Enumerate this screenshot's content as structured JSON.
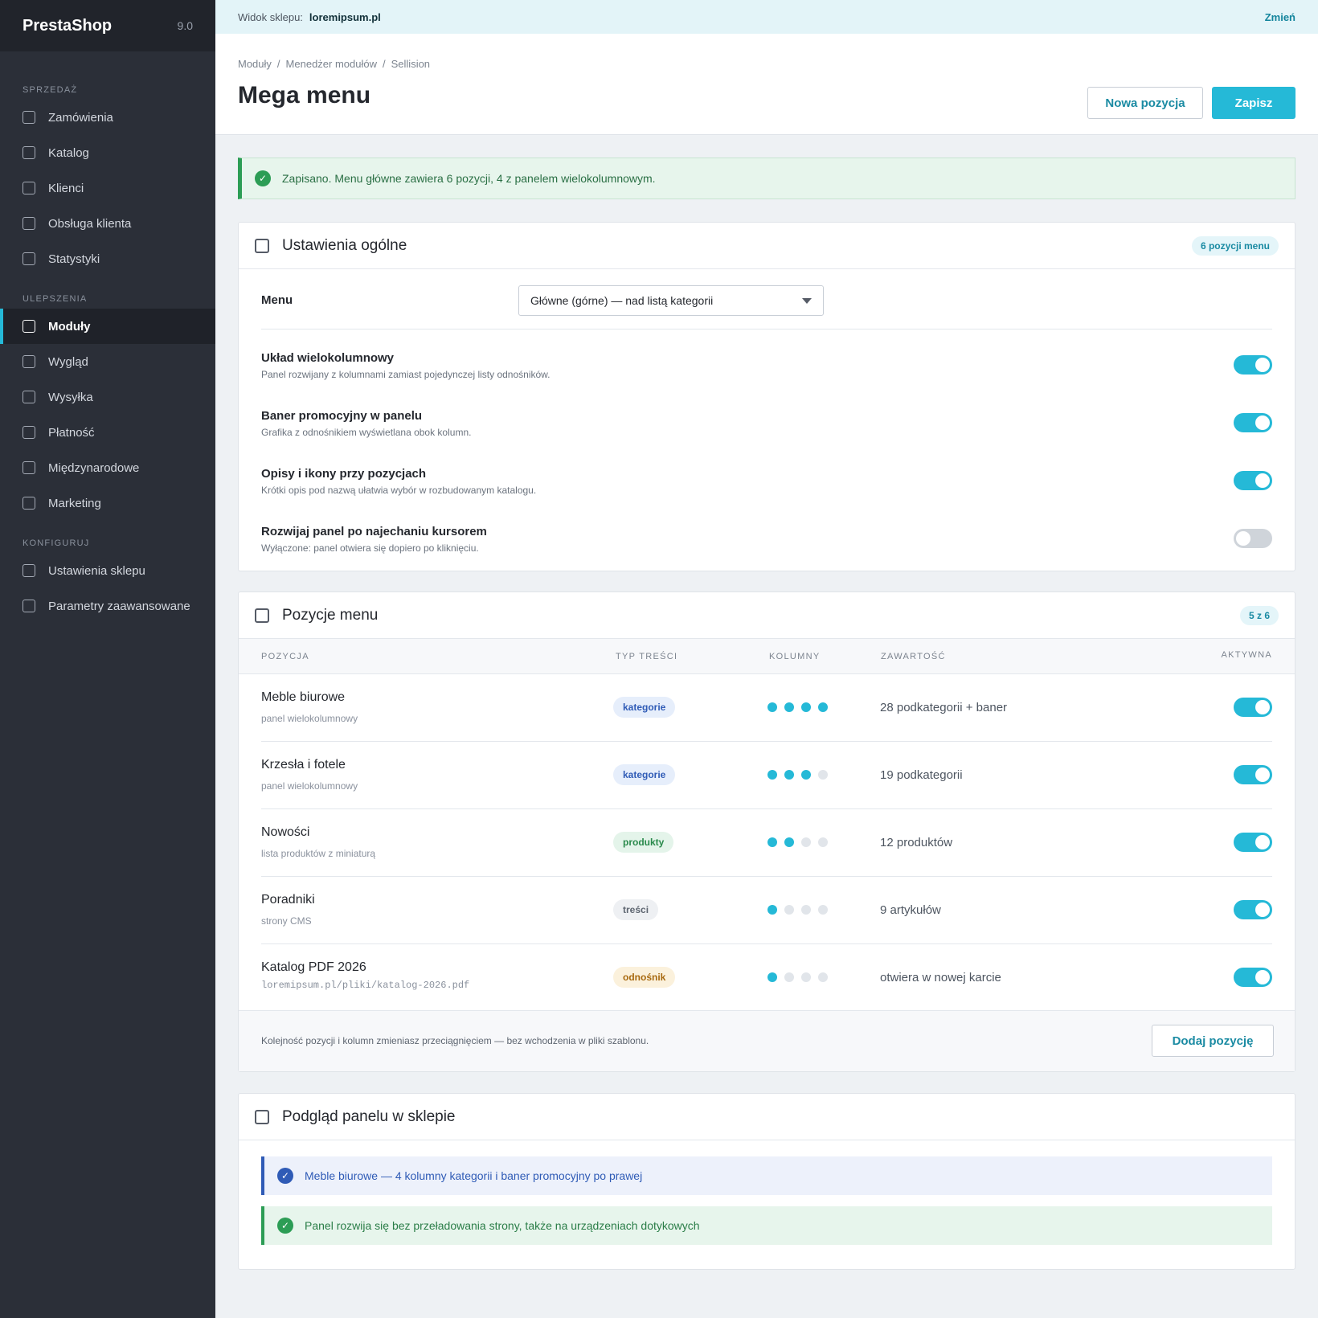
{
  "app": {
    "name": "PrestaShop",
    "version": "9.0"
  },
  "sidebar": {
    "sections": [
      {
        "label": "SPRZEDAŻ",
        "items": [
          {
            "label": "Zamówienia"
          },
          {
            "label": "Katalog"
          },
          {
            "label": "Klienci"
          },
          {
            "label": "Obsługa klienta"
          },
          {
            "label": "Statystyki"
          }
        ]
      },
      {
        "label": "ULEPSZENIA",
        "items": [
          {
            "label": "Moduły",
            "active": true
          },
          {
            "label": "Wygląd"
          },
          {
            "label": "Wysyłka"
          },
          {
            "label": "Płatność"
          },
          {
            "label": "Międzynarodowe"
          },
          {
            "label": "Marketing"
          }
        ]
      },
      {
        "label": "KONFIGURUJ",
        "items": [
          {
            "label": "Ustawienia sklepu"
          },
          {
            "label": "Parametry zaawansowane"
          }
        ]
      }
    ]
  },
  "topbar": {
    "label": "Widok sklepu:",
    "shop": "loremipsum.pl",
    "change": "Zmień"
  },
  "breadcrumb": [
    "Moduły",
    "Menedżer modułów",
    "Sellision"
  ],
  "page": {
    "title": "Mega menu",
    "new_button": "Nowa pozycja",
    "save_button": "Zapisz"
  },
  "alert": {
    "text": "Zapisano. Menu główne zawiera 6 pozycji, 4 z panelem wielokolumnowym."
  },
  "general": {
    "title": "Ustawienia ogólne",
    "badge": "6 pozycji menu",
    "menu_label": "Menu",
    "menu_value": "Główne (górne) — nad listą kategorii",
    "options": [
      {
        "title": "Układ wielokolumnowy",
        "desc": "Panel rozwijany z kolumnami zamiast pojedynczej listy odnośników.",
        "on": true
      },
      {
        "title": "Baner promocyjny w panelu",
        "desc": "Grafika z odnośnikiem wyświetlana obok kolumn.",
        "on": true
      },
      {
        "title": "Opisy i ikony przy pozycjach",
        "desc": "Krótki opis pod nazwą ułatwia wybór w rozbudowanym katalogu.",
        "on": true
      },
      {
        "title": "Rozwijaj panel po najechaniu kursorem",
        "desc": "Wyłączone: panel otwiera się dopiero po kliknięciu.",
        "on": false
      }
    ]
  },
  "items": {
    "title": "Pozycje menu",
    "badge": "5 z 6",
    "headers": {
      "position": "POZYCJA",
      "type": "TYP TREŚCI",
      "columns": "KOLUMNY",
      "content": "ZAWARTOŚĆ",
      "active": "AKTYWNA"
    },
    "rows": [
      {
        "name": "Meble biurowe",
        "sub": "panel wielokolumnowy",
        "type": "kategorie",
        "type_bg": "#e6eefb",
        "type_color": "#2f5bb6",
        "columns": 4,
        "content": "28 podkategorii + baner",
        "active": true
      },
      {
        "name": "Krzesła i fotele",
        "sub": "panel wielokolumnowy",
        "type": "kategorie",
        "type_bg": "#e6eefb",
        "type_color": "#2f5bb6",
        "columns": 3,
        "content": "19 podkategorii",
        "active": true
      },
      {
        "name": "Nowości",
        "sub": "lista produktów z miniaturą",
        "type": "produkty",
        "type_bg": "#e4f4ea",
        "type_color": "#2a8a4c",
        "columns": 2,
        "content": "12 produktów",
        "active": true
      },
      {
        "name": "Poradniki",
        "sub": "strony CMS",
        "type": "treści",
        "type_bg": "#eef0f3",
        "type_color": "#5d6570",
        "columns": 1,
        "content": "9 artykułów",
        "active": true
      },
      {
        "name": "Katalog PDF 2026",
        "sub": "loremipsum.pl/pliki/katalog-2026.pdf",
        "type": "odnośnik",
        "type_bg": "#fbf1dc",
        "type_color": "#a8690f",
        "columns": 1,
        "content": "otwiera w nowej karcie",
        "active": true
      }
    ],
    "footer_text": "Kolejność pozycji i kolumn zmieniasz przeciągnięciem — bez wchodzenia w pliki szablonu.",
    "add_button": "Dodaj pozycję"
  },
  "preview": {
    "title": "Podgląd panelu w sklepie",
    "notes": [
      {
        "text": "Meble biurowe — 4 kolumny kategorii i baner promocyjny po prawej",
        "kind": "info"
      },
      {
        "text": "Panel rozwija się bez przeładowania strony, także na urządzeniach dotykowych",
        "kind": "ok"
      }
    ]
  },
  "colors": {
    "accent": "#25b9d7",
    "sidebar": "#2b2f38",
    "success": "#2c9d55",
    "info": "#2f5bb6"
  }
}
